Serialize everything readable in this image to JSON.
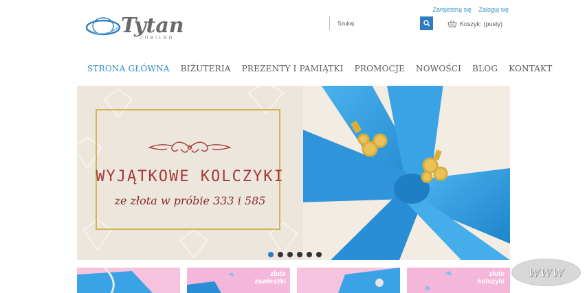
{
  "brand": {
    "name": "Tytan",
    "tagline": "JUBILER"
  },
  "top_links": {
    "register": "Zarejestruj się",
    "login": "Zaloguj się"
  },
  "search": {
    "placeholder": "Szukaj"
  },
  "cart": {
    "label": "Koszyk:",
    "value": "(pusty)"
  },
  "nav": {
    "items": [
      {
        "label": "Strona główna",
        "active": true
      },
      {
        "label": "Biżuteria"
      },
      {
        "label": "Prezenty i Pamiątki"
      },
      {
        "label": "Promocje"
      },
      {
        "label": "Nowości"
      },
      {
        "label": "Blog"
      },
      {
        "label": "Kontakt"
      }
    ]
  },
  "banner": {
    "headline": "WYJĄTKOWE KOLCZYKI",
    "subline": "ze złota w próbie 333 i 585",
    "slide_count": 6,
    "active_slide": 1
  },
  "thumbnails": [
    {
      "label": ""
    },
    {
      "label_line1": "złote",
      "label_line2": "zawieszki"
    },
    {
      "label": ""
    },
    {
      "label_line1": "złote",
      "label_line2": "kolczyki"
    }
  ],
  "www_badge": "WWW",
  "colors": {
    "accent_blue": "#2f7dc1",
    "link_blue": "#2e8ec6",
    "gold": "#d2b35a",
    "burgundy": "#a43a3a",
    "ribbon_blue": "#3a9fe0",
    "pink": "#f4b7da"
  }
}
